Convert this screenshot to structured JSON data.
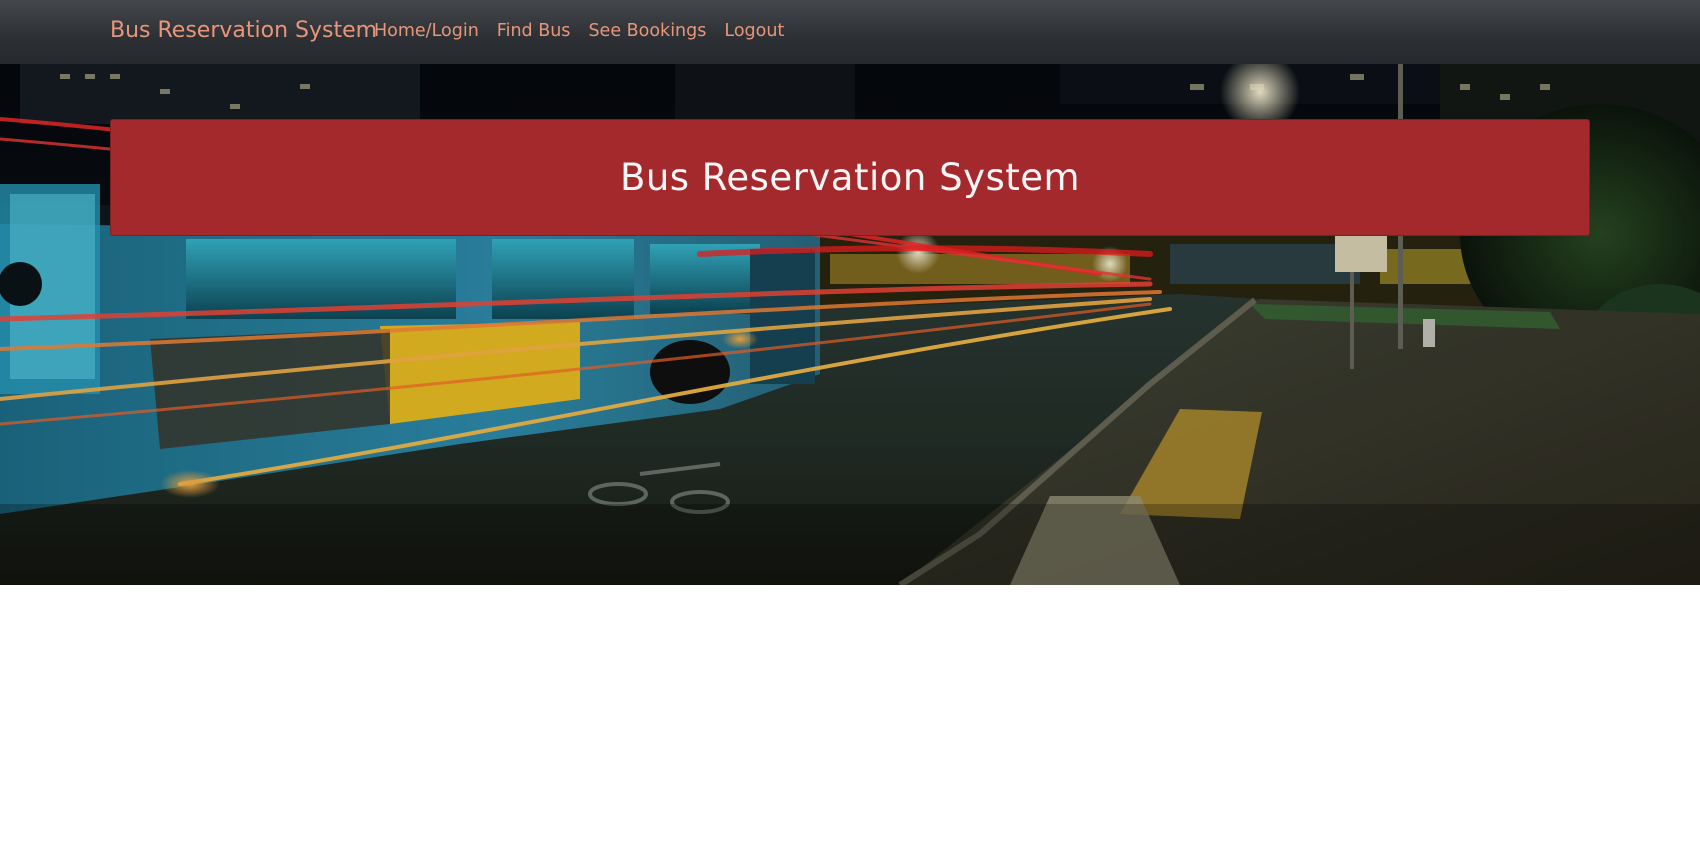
{
  "navbar": {
    "brand": "Bus Reservation System",
    "links": [
      {
        "label": "Home/Login"
      },
      {
        "label": "Find Bus"
      },
      {
        "label": "See Bookings"
      },
      {
        "label": "Logout"
      }
    ],
    "link_color": "#e8967a",
    "background_color": "#2c2f33"
  },
  "hero": {
    "image": "night-street-bus-photo",
    "banner": {
      "title": "Bus Reservation System",
      "color": "#a3292d"
    }
  }
}
